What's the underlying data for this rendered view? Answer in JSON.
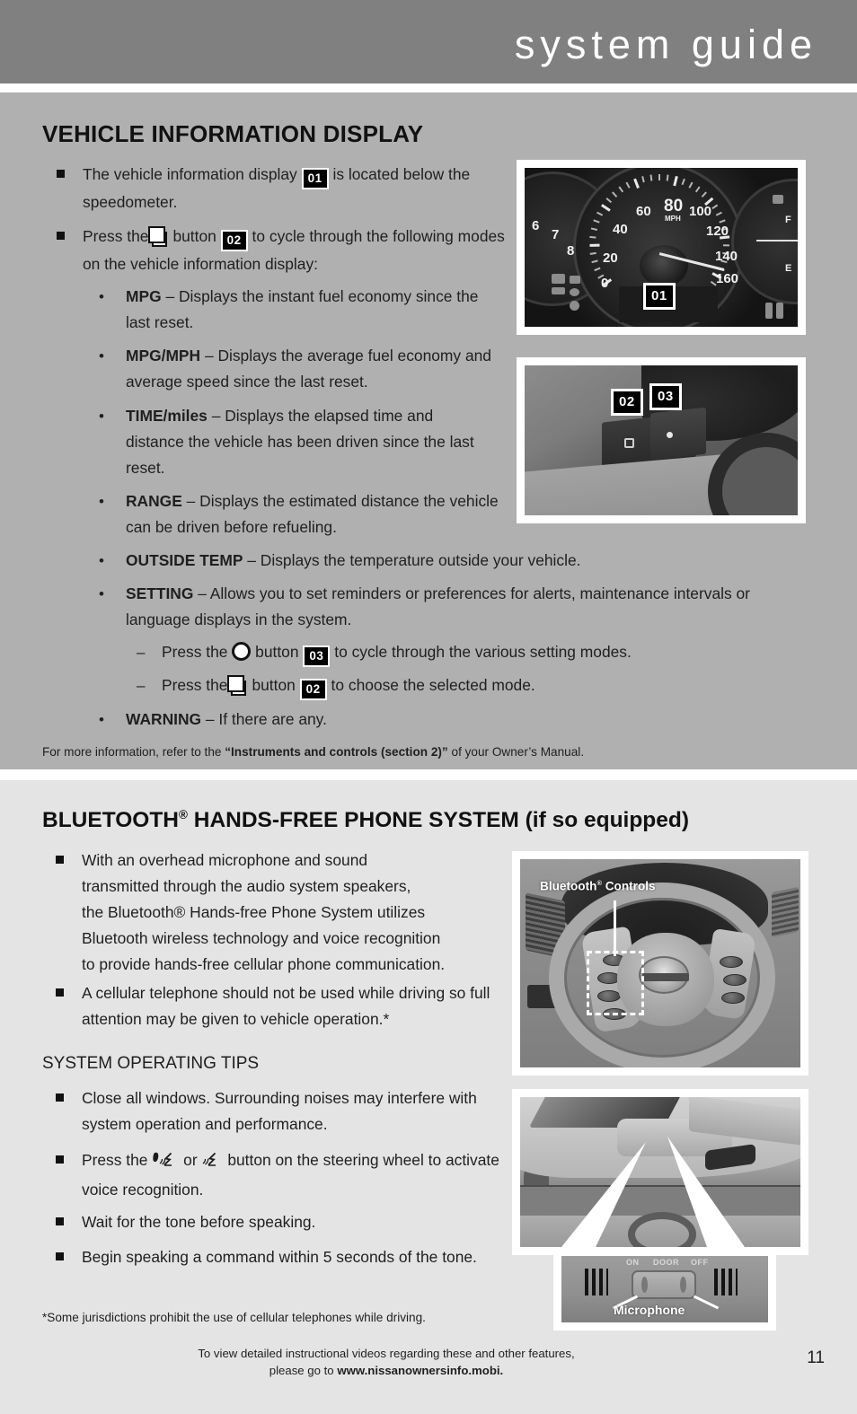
{
  "header": {
    "title": "system guide"
  },
  "section_one": {
    "heading": "VEHICLE INFORMATION DISPLAY",
    "bullets": {
      "b1_a": "The vehicle information display",
      "b1_chip": "01",
      "b1_b": "is located below the speedometer.",
      "b2_a": "Press the",
      "b2_b": "button",
      "b2_chip": "02",
      "b2_c": "to cycle through the following modes on the vehicle information display:"
    },
    "modes": [
      {
        "term": "MPG",
        "desc": "– Displays the instant fuel economy since the last reset."
      },
      {
        "term": "MPG/MPH",
        "desc": "– Displays the average fuel economy and average speed since the last reset."
      },
      {
        "term": "TIME/miles",
        "desc": "– Displays the elapsed time and distance the vehicle has been driven since the last reset."
      },
      {
        "term": "RANGE",
        "desc": "– Displays the estimated distance the vehicle can be driven before refueling."
      },
      {
        "term": "OUTSIDE TEMP",
        "desc": "– Displays the temperature outside your vehicle."
      },
      {
        "term": "SETTING",
        "desc": "– Allows you to set reminders or preferences for alerts, maintenance intervals or language displays in the system."
      }
    ],
    "sub_steps": [
      {
        "pre": "Press the",
        "mid": "button",
        "chip": "03",
        "post": "to cycle through the various setting modes."
      },
      {
        "pre": "Press the",
        "mid": "button",
        "chip": "02",
        "post": "to choose the selected mode."
      }
    ],
    "warning": {
      "term": "WARNING",
      "desc": "– If there are any."
    },
    "footnote": {
      "a": "For more information, refer to the ",
      "bold": "“Instruments and controls (section 2)”",
      "b": " of your Owner’s Manual."
    }
  },
  "section_two": {
    "heading_main": "BLUETOOTH",
    "heading_sup": "®",
    "heading_rest": " HANDS-FREE PHONE SYSTEM (if so equipped)",
    "bullet1": "With an overhead microphone and sound transmitted through the audio system speakers, the Bluetooth® Hands-free Phone System utilizes Bluetooth wireless technology and voice recognition to provide hands-free cellular phone communication.",
    "bullet1_lines": [
      "With an overhead microphone and sound",
      "transmitted through the audio system speakers,",
      "the Bluetooth® Hands-free Phone System utilizes",
      "Bluetooth wireless technology and voice recognition",
      "to provide hands-free cellular phone communication."
    ],
    "bullet2": "A cellular telephone should not be used while driving so full attention may be given to vehicle operation.*",
    "tips_heading": "SYSTEM OPERATING TIPS",
    "tips": [
      "Close all windows. Surrounding noises may interfere with system operation and performance.",
      "Wait for the tone before speaking.",
      "Begin speaking a command within 5 seconds of the tone."
    ],
    "tip_voice": {
      "a": "Press the",
      "or": "or",
      "b": "button on the steering wheel to activate voice recognition."
    },
    "footnote": "*Some jurisdictions prohibit the use of cellular telephones while driving."
  },
  "photos": {
    "cluster": {
      "chip": "01",
      "speed_labels": [
        "0",
        "20",
        "40",
        "60",
        "80",
        "100",
        "120",
        "140",
        "160"
      ],
      "mph_label": "MPH",
      "tach_labels": [
        "6",
        "7",
        "8"
      ],
      "fuel_labels": [
        "F",
        "E"
      ]
    },
    "buttons": {
      "chip_left": "02",
      "chip_right": "03"
    },
    "wheel": {
      "callout_main": "Bluetooth",
      "callout_sup": "®",
      "callout_rest": " Controls"
    },
    "microphone": {
      "label": "Microphone",
      "switch_labels": [
        "ON",
        "DOOR",
        "OFF"
      ]
    }
  },
  "footer": {
    "line1": "To view detailed instructional videos regarding these and other features,",
    "line2_a": "please go to ",
    "line2_b": "www.nissanownersinfo.mobi.",
    "page_number": "11"
  }
}
